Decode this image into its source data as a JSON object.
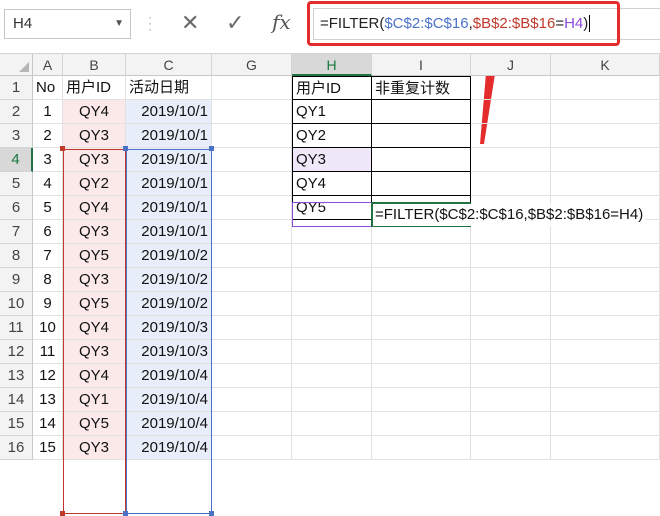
{
  "name_box": {
    "value": "H4"
  },
  "formula_bar": {
    "cancel_symbol": "✕",
    "enter_symbol": "✓",
    "fx_label": "fx",
    "formula_parts": [
      "=FILTER(",
      "$C$2:$C$16",
      ",",
      "$B$2:$B$16",
      "=",
      "H4",
      ")"
    ]
  },
  "cell_edit_text": "=FILTER($C$2:$C$16,$B$2:$B$16=H4)",
  "columns": [
    "A",
    "B",
    "C",
    "G",
    "H",
    "I",
    "J",
    "K"
  ],
  "rows": [
    "1",
    "2",
    "3",
    "4",
    "5",
    "6",
    "7",
    "8",
    "9",
    "10",
    "11",
    "12",
    "13",
    "14",
    "15",
    "16"
  ],
  "table_left": {
    "headers": [
      "No",
      "用户ID",
      "活动日期"
    ],
    "rows": [
      [
        "1",
        "QY4",
        "2019/10/1"
      ],
      [
        "2",
        "QY3",
        "2019/10/1"
      ],
      [
        "3",
        "QY3",
        "2019/10/1"
      ],
      [
        "4",
        "QY2",
        "2019/10/1"
      ],
      [
        "5",
        "QY4",
        "2019/10/1"
      ],
      [
        "6",
        "QY3",
        "2019/10/1"
      ],
      [
        "7",
        "QY5",
        "2019/10/2"
      ],
      [
        "8",
        "QY3",
        "2019/10/2"
      ],
      [
        "9",
        "QY5",
        "2019/10/2"
      ],
      [
        "10",
        "QY4",
        "2019/10/3"
      ],
      [
        "11",
        "QY3",
        "2019/10/3"
      ],
      [
        "12",
        "QY4",
        "2019/10/4"
      ],
      [
        "13",
        "QY1",
        "2019/10/4"
      ],
      [
        "14",
        "QY5",
        "2019/10/4"
      ],
      [
        "15",
        "QY3",
        "2019/10/4"
      ]
    ]
  },
  "table_right": {
    "headers": [
      "用户ID",
      "非重复计数"
    ],
    "ids": [
      "QY1",
      "QY2",
      "QY3",
      "QY4",
      "QY5"
    ]
  },
  "colors": {
    "highlight_red": "#e52c2c",
    "ref_c_blue": "#4a73c8",
    "ref_b_red": "#c0392b",
    "ref_h_purple": "#8d4bd9",
    "active_green": "#217346"
  }
}
